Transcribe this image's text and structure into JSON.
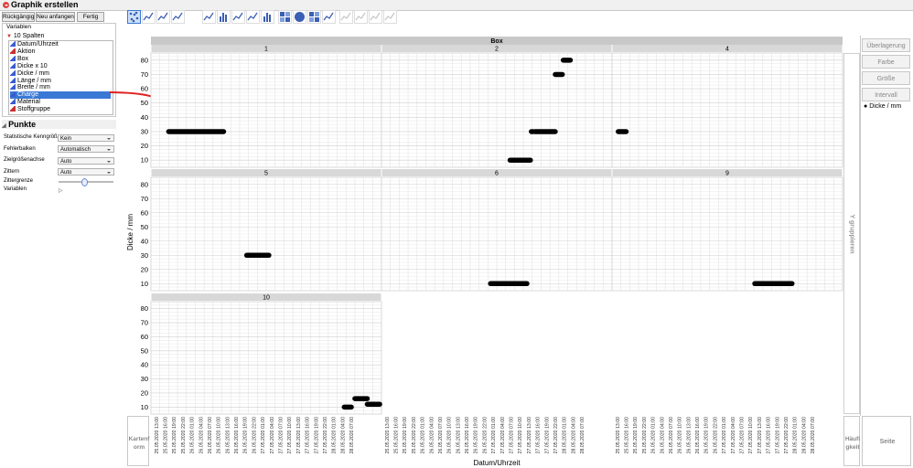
{
  "window_title": "Graphik erstellen",
  "toolbar": {
    "undo": "Rückgängig",
    "restart": "Neu anfangen",
    "done": "Fertig"
  },
  "variables": {
    "title": "Variablen",
    "header": "10 Spalten",
    "items": [
      {
        "label": "Datum/Uhrzeit",
        "kind": "continuous"
      },
      {
        "label": "Aktion",
        "kind": "nominal"
      },
      {
        "label": "Box",
        "kind": "continuous"
      },
      {
        "label": "Dicke x 10",
        "kind": "continuous"
      },
      {
        "label": "Dicke / mm",
        "kind": "continuous"
      },
      {
        "label": "Länge / mm",
        "kind": "continuous"
      },
      {
        "label": "Breite / mm",
        "kind": "continuous"
      },
      {
        "label": "Charge",
        "kind": "continuous",
        "selected": true
      },
      {
        "label": "Material",
        "kind": "continuous"
      },
      {
        "label": "Stoffgruppe",
        "kind": "nominal"
      }
    ]
  },
  "points_panel": {
    "title": "Punkte",
    "rows": [
      {
        "label": "Statistische Kenngröße",
        "value": "Kein"
      },
      {
        "label": "Fehlerbalken",
        "value": "Automatisch"
      },
      {
        "label": "Zielgrößenachse",
        "value": "Auto"
      },
      {
        "label": "Zittern",
        "value": "Auto"
      }
    ],
    "jitter_limit_label": "Zittergrenze",
    "variables_label": "Variablen"
  },
  "chart_tools": [
    "points-icon",
    "contour-icon",
    "line-of-fit-icon",
    "ellipse-icon",
    "line-icon",
    "bar-icon",
    "area-icon",
    "box-plot-icon",
    "histogram-icon",
    "heatmap-icon",
    "pie-icon",
    "treemap-icon",
    "mosaic-icon",
    "caption-box-icon",
    "formula-icon",
    "map-shapes-icon",
    "parallel-icon"
  ],
  "right_buttons": [
    "Überlagerung",
    "Farbe",
    "Größe",
    "Intervall"
  ],
  "legend": {
    "label": "Dicke / mm"
  },
  "group_y_label": "Y gruppieren",
  "wrap_label": "Kartenform",
  "freq_label": "Häufigkeit",
  "page_label": "Seite",
  "colors": {
    "accent": "#3a78d6",
    "arrow": "#e02020",
    "point": "#000000"
  },
  "chart_data": {
    "type": "scatter",
    "group_title": "Box",
    "xlabel": "Datum/Uhrzeit",
    "ylabel": "Dicke / mm",
    "ylim": [
      5,
      85
    ],
    "y_ticks": [
      10,
      20,
      30,
      40,
      50,
      60,
      70,
      80
    ],
    "x_ticks": [
      "25.05.2020 13:00",
      "25.05.2020 16:00",
      "25.05.2020 19:00",
      "25.05.2020 22:00",
      "26.05.2020 01:00",
      "26.05.2020 04:00",
      "26.05.2020 07:00",
      "26.05.2020 10:00",
      "26.05.2020 13:00",
      "26.05.2020 16:00",
      "26.05.2020 19:00",
      "26.05.2020 22:00",
      "27.05.2020 01:00",
      "27.05.2020 04:00",
      "27.05.2020 07:00",
      "27.05.2020 10:00",
      "27.05.2020 13:00",
      "27.05.2020 16:00",
      "27.05.2020 19:00",
      "27.05.2020 22:00",
      "28.05.2020 01:00",
      "28.05.2020 04:00",
      "28.05.2020 07:00"
    ],
    "panels": [
      {
        "title": "1",
        "segments": [
          {
            "x": [
              2.0,
              8.2
            ],
            "y": 30
          }
        ]
      },
      {
        "title": "2",
        "segments": [
          {
            "x": [
              14.5,
              16.8
            ],
            "y": 10
          },
          {
            "x": [
              16.9,
              17.1
            ],
            "y": 30
          },
          {
            "x": [
              17.3,
              19.6
            ],
            "y": 30
          },
          {
            "x": [
              19.6,
              20.4
            ],
            "y": 70
          },
          {
            "x": [
              20.5,
              21.3
            ],
            "y": 80
          }
        ]
      },
      {
        "title": "4",
        "segments": [
          {
            "x": [
              0.7,
              1.6
            ],
            "y": 30
          }
        ]
      },
      {
        "title": "5",
        "segments": [
          {
            "x": [
              10.8,
              13.3
            ],
            "y": 30
          }
        ]
      },
      {
        "title": "6",
        "segments": [
          {
            "x": [
              12.3,
              16.4
            ],
            "y": 10
          }
        ]
      },
      {
        "title": "9",
        "segments": [
          {
            "x": [
              16.1,
              20.3
            ],
            "y": 10
          }
        ]
      },
      {
        "title": "10",
        "segments": [
          {
            "x": [
              21.8,
              22.6
            ],
            "y": 10
          },
          {
            "x": [
              23.0,
              24.4
            ],
            "y": 16
          },
          {
            "x": [
              24.4,
              25.8
            ],
            "y": 12
          }
        ]
      }
    ]
  }
}
